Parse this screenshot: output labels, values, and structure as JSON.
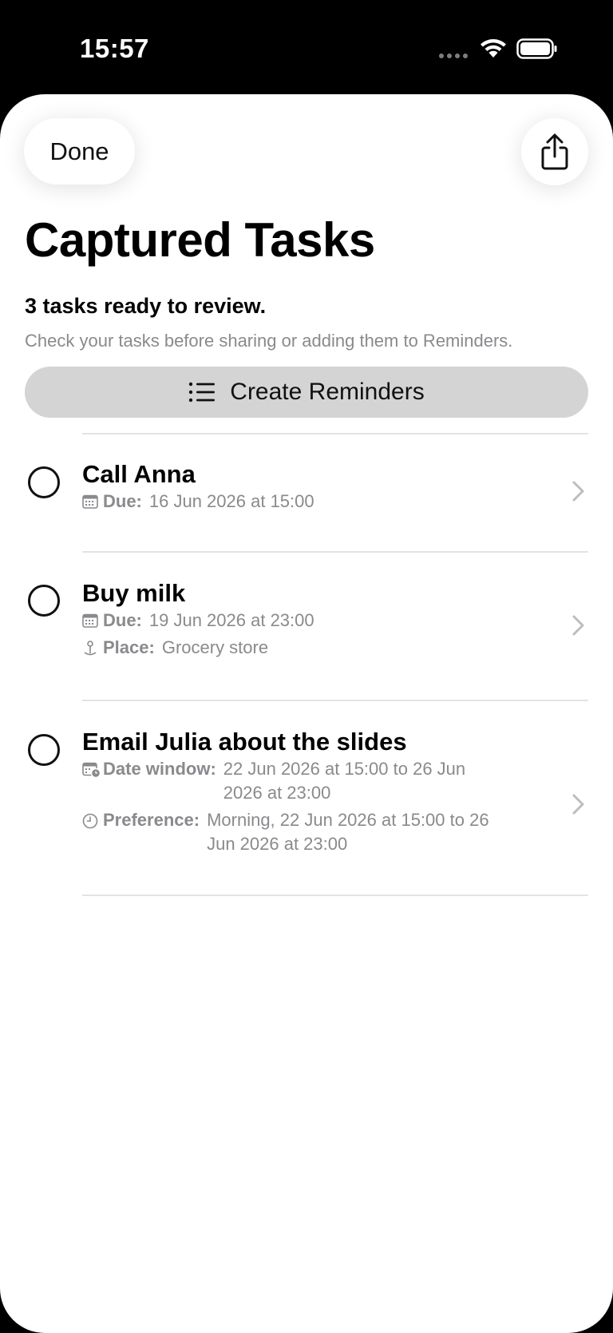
{
  "status_bar": {
    "time": "15:57"
  },
  "header": {
    "done_label": "Done"
  },
  "page": {
    "title": "Captured Tasks",
    "summary": "3 tasks ready to review.",
    "subtitle": "Check your tasks before sharing or adding them to Reminders.",
    "create_button_label": "Create Reminders"
  },
  "tasks": [
    {
      "title": "Call Anna",
      "meta": [
        {
          "icon": "calendar-icon",
          "label": "Due:",
          "value": "16 Jun 2026 at 15:00"
        }
      ]
    },
    {
      "title": "Buy milk",
      "meta": [
        {
          "icon": "calendar-icon",
          "label": "Due:",
          "value": "19 Jun 2026 at 23:00"
        },
        {
          "icon": "pin-icon",
          "label": "Place:",
          "value": "Grocery store"
        }
      ]
    },
    {
      "title": "Email Julia about the slides",
      "meta": [
        {
          "icon": "calendar-clock-icon",
          "label": "Date window:",
          "value": "22 Jun 2026 at 15:00 to 26 Jun\n2026 at 23:00"
        },
        {
          "icon": "clock-icon",
          "label": "Preference:",
          "value": "Morning, 22 Jun 2026 at 15:00 to 26\nJun 2026 at 23:00"
        }
      ]
    }
  ]
}
